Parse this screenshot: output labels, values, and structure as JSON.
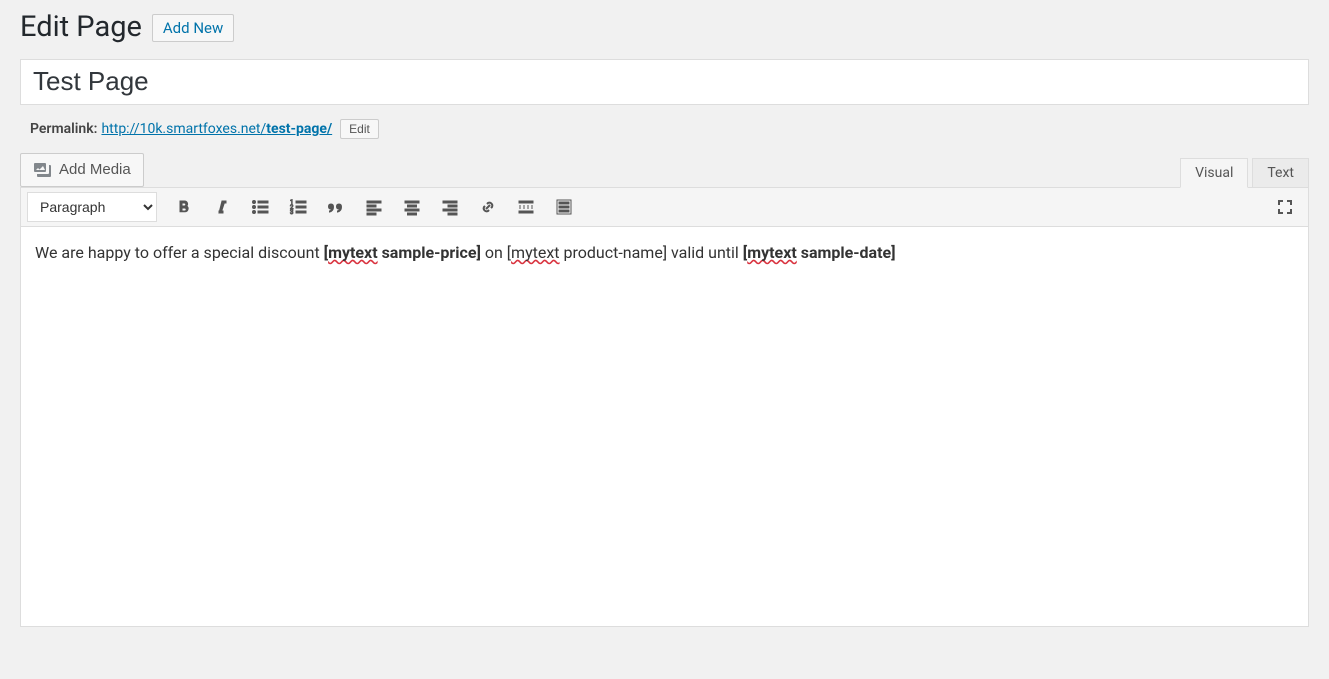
{
  "header": {
    "title": "Edit Page",
    "add_new_label": "Add New"
  },
  "post_title": "Test Page",
  "permalink": {
    "label": "Permalink:",
    "base": "http://10k.smartfoxes.net/",
    "slug": "test-page/",
    "edit_label": "Edit"
  },
  "media": {
    "add_media_label": "Add Media"
  },
  "tabs": {
    "visual": "Visual",
    "text": "Text",
    "active": "visual"
  },
  "toolbar": {
    "format_value": "Paragraph",
    "buttons": [
      "bold",
      "italic",
      "bulleted-list",
      "numbered-list",
      "blockquote",
      "align-left",
      "align-center",
      "align-right",
      "link",
      "read-more",
      "toolbar-toggle"
    ],
    "right_buttons": [
      "fullscreen"
    ]
  },
  "content": {
    "segments": [
      {
        "text": "We are happy to offer a special discount ",
        "bold": false,
        "spell": false
      },
      {
        "text": "[",
        "bold": true,
        "spell": false
      },
      {
        "text": "mytext",
        "bold": true,
        "spell": true
      },
      {
        "text": " sample-price]",
        "bold": true,
        "spell": false
      },
      {
        "text": " on [",
        "bold": false,
        "spell": false
      },
      {
        "text": "mytext",
        "bold": false,
        "spell": true
      },
      {
        "text": " product-name] valid until ",
        "bold": false,
        "spell": false
      },
      {
        "text": "[",
        "bold": true,
        "spell": false
      },
      {
        "text": "mytext",
        "bold": true,
        "spell": true
      },
      {
        "text": " sample-date]",
        "bold": true,
        "spell": false
      }
    ]
  }
}
